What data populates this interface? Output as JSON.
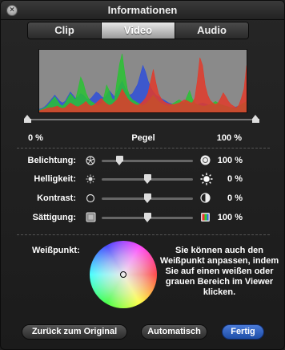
{
  "window": {
    "title": "Informationen",
    "close_glyph": "×"
  },
  "tabs": [
    {
      "label": "Clip",
      "active": false
    },
    {
      "label": "Video",
      "active": true
    },
    {
      "label": "Audio",
      "active": false
    }
  ],
  "histogram": {
    "red": [
      2,
      3,
      4,
      5,
      6,
      6,
      7,
      8,
      6,
      5,
      6,
      9,
      12,
      10,
      8,
      7,
      9,
      11,
      14,
      10,
      8,
      9,
      12,
      15,
      18,
      14,
      11,
      9,
      10,
      13,
      16,
      22,
      30,
      24,
      18,
      14,
      12,
      10,
      9,
      11,
      14,
      18,
      25,
      40,
      55,
      38,
      24,
      18,
      14,
      12,
      11,
      10,
      10,
      11,
      12,
      14,
      16,
      15,
      13,
      12,
      18,
      40,
      70,
      60,
      35,
      22,
      15,
      12,
      10,
      12,
      18,
      25,
      20,
      14,
      10,
      8,
      6,
      9,
      18,
      30,
      60
    ],
    "green": [
      3,
      4,
      6,
      8,
      12,
      16,
      20,
      15,
      10,
      8,
      12,
      18,
      24,
      20,
      16,
      30,
      45,
      38,
      25,
      18,
      14,
      12,
      10,
      9,
      12,
      20,
      35,
      28,
      18,
      15,
      40,
      62,
      75,
      50,
      30,
      20,
      16,
      14,
      12,
      10,
      9,
      11,
      14,
      18,
      22,
      18,
      14,
      12,
      10,
      9,
      8,
      10,
      12,
      14,
      16,
      14,
      12,
      20,
      28,
      18,
      12,
      10,
      9,
      8,
      8,
      9,
      10,
      12,
      14,
      12,
      10,
      9,
      8,
      7,
      6,
      5,
      6,
      8,
      10,
      12,
      14
    ],
    "blue": [
      4,
      5,
      7,
      10,
      14,
      18,
      22,
      18,
      14,
      12,
      14,
      20,
      26,
      22,
      18,
      20,
      24,
      22,
      18,
      16,
      18,
      22,
      26,
      24,
      20,
      18,
      22,
      28,
      24,
      20,
      26,
      34,
      40,
      32,
      26,
      22,
      24,
      30,
      36,
      48,
      60,
      52,
      40,
      32,
      26,
      22,
      20,
      18,
      16,
      14,
      12,
      11,
      10,
      10,
      11,
      12,
      12,
      11,
      10,
      9,
      9,
      10,
      11,
      12,
      11,
      10,
      9,
      8,
      8,
      9,
      10,
      9,
      8,
      7,
      6,
      6,
      7,
      8,
      9,
      10,
      10
    ]
  },
  "levels": {
    "low_label": "0 %",
    "center_label": "Pegel",
    "high_label": "100 %",
    "low": 0,
    "high": 100
  },
  "adjustments": [
    {
      "label": "Belichtung:",
      "value_text": "100 %",
      "position": 0.2,
      "icon_left": "aperture-small-icon",
      "icon_right": "aperture-large-icon"
    },
    {
      "label": "Helligkeit:",
      "value_text": "0 %",
      "position": 0.5,
      "icon_left": "sun-small-icon",
      "icon_right": "sun-large-icon"
    },
    {
      "label": "Kontrast:",
      "value_text": "0 %",
      "position": 0.5,
      "icon_left": "contrast-low-icon",
      "icon_right": "contrast-high-icon"
    },
    {
      "label": "Sättigung:",
      "value_text": "100 %",
      "position": 0.5,
      "icon_left": "saturation-low-icon",
      "icon_right": "saturation-high-icon"
    }
  ],
  "white_point": {
    "label": "Weißpunkt:",
    "help": "Sie können auch den Weißpunkt anpassen, indem Sie auf einen weißen oder grauen Bereich im Viewer klicken."
  },
  "buttons": {
    "reset": "Zurück zum Original",
    "auto": "Automatisch",
    "done": "Fertig"
  },
  "colors": {
    "accent": "#2b5fc7",
    "histogram_red": "#e23a2a",
    "histogram_green": "#29c232",
    "histogram_blue": "#2f4fd8",
    "histogram_bg": "#8a8a8a"
  }
}
